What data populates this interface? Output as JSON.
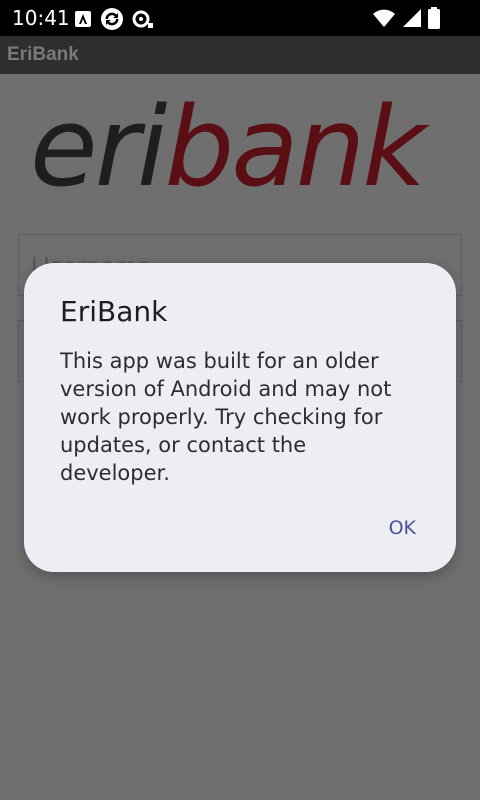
{
  "status_bar": {
    "time": "10:41",
    "left_icons": [
      "android-auto-icon",
      "sync-icon",
      "debug-icon"
    ],
    "right_icons": [
      "wifi-icon",
      "signal-icon",
      "battery-icon"
    ]
  },
  "app_bar": {
    "title": "EriBank"
  },
  "logo": {
    "part1": "eri",
    "part2": "bank",
    "color_part1": "#1e1e1e",
    "color_part2": "#5a0f14"
  },
  "login": {
    "username_placeholder": "Username",
    "password_placeholder": ""
  },
  "dialog": {
    "title": "EriBank",
    "message": "This app was built for an older version of Android and may not work properly. Try checking for updates, or contact the developer.",
    "ok_label": "OK",
    "accent_color": "#4a5494"
  }
}
